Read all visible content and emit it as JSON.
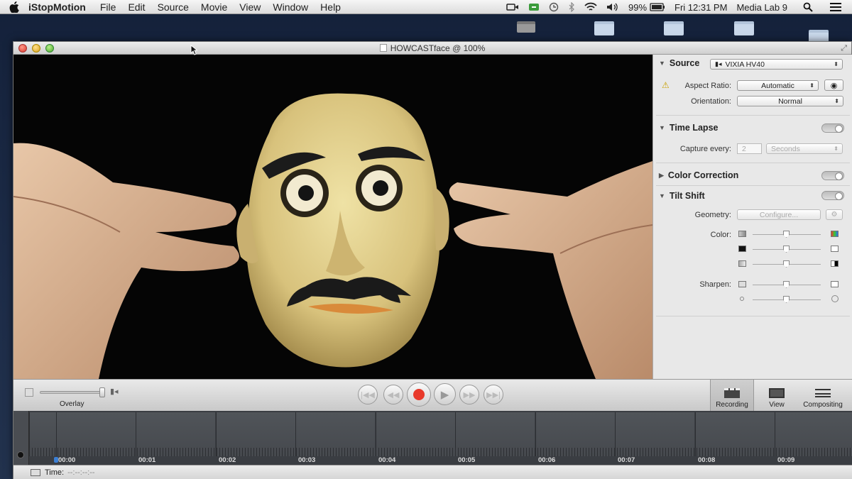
{
  "menubar": {
    "app": "iStopMotion",
    "items": [
      "File",
      "Edit",
      "Source",
      "Movie",
      "View",
      "Window",
      "Help"
    ],
    "battery": "99%",
    "clock": "Fri 12:31 PM",
    "user": "Media Lab 9"
  },
  "window": {
    "title": "HOWCASTface @ 100%"
  },
  "inspector": {
    "source": {
      "title": "Source",
      "device": "VIXIA HV40",
      "aspect_label": "Aspect Ratio:",
      "aspect_value": "Automatic",
      "orientation_label": "Orientation:",
      "orientation_value": "Normal"
    },
    "time_lapse": {
      "title": "Time Lapse",
      "capture_label": "Capture every:",
      "capture_value": "2",
      "unit": "Seconds"
    },
    "color_correction": {
      "title": "Color Correction"
    },
    "tilt_shift": {
      "title": "Tilt Shift",
      "geometry_label": "Geometry:",
      "configure_label": "Configure...",
      "color_label": "Color:",
      "sharpen_label": "Sharpen:"
    }
  },
  "controls": {
    "overlay_label": "Overlay",
    "tabs": [
      "Recording",
      "View",
      "Compositing"
    ]
  },
  "timeline": {
    "ticks": [
      "00:00",
      "00:01",
      "00:02",
      "00:03",
      "00:04",
      "00:05",
      "00:06",
      "00:07",
      "00:08",
      "00:09"
    ]
  },
  "status": {
    "time_label": "Time:",
    "time_value": "--:--:--:--"
  },
  "colors": {
    "record": "#e8392a",
    "accent": "#3b7fd4"
  }
}
